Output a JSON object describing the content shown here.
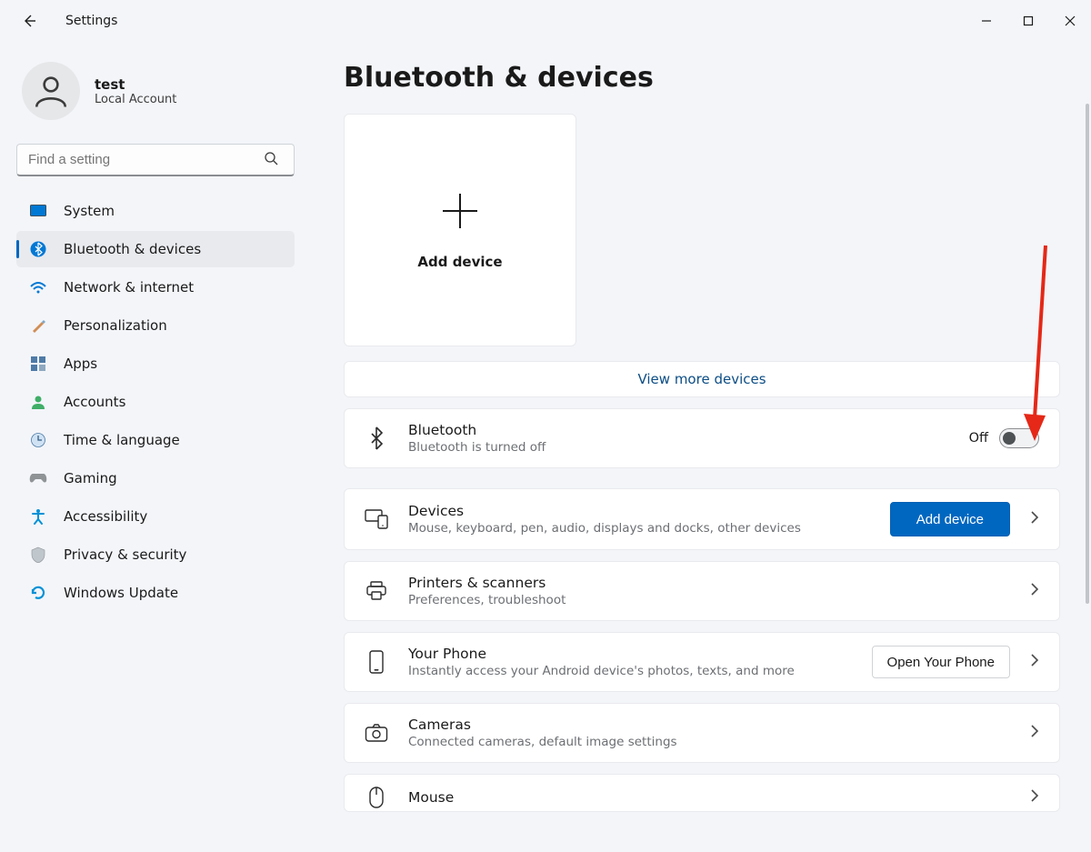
{
  "window": {
    "app_title": "Settings"
  },
  "account": {
    "name": "test",
    "subtitle": "Local Account"
  },
  "search": {
    "placeholder": "Find a setting"
  },
  "nav": {
    "items": [
      {
        "key": "system",
        "label": "System"
      },
      {
        "key": "bluetooth",
        "label": "Bluetooth & devices"
      },
      {
        "key": "network",
        "label": "Network & internet"
      },
      {
        "key": "personal",
        "label": "Personalization"
      },
      {
        "key": "apps",
        "label": "Apps"
      },
      {
        "key": "accounts",
        "label": "Accounts"
      },
      {
        "key": "time",
        "label": "Time & language"
      },
      {
        "key": "gaming",
        "label": "Gaming"
      },
      {
        "key": "accessibility",
        "label": "Accessibility"
      },
      {
        "key": "privacy",
        "label": "Privacy & security"
      },
      {
        "key": "update",
        "label": "Windows Update"
      }
    ],
    "selected": "bluetooth"
  },
  "main": {
    "page_title": "Bluetooth & devices",
    "add_device": "Add device",
    "view_more": "View more devices",
    "bluetooth": {
      "title": "Bluetooth",
      "subtitle": "Bluetooth is turned off",
      "state_label": "Off"
    },
    "devices": {
      "title": "Devices",
      "subtitle": "Mouse, keyboard, pen, audio, displays and docks, other devices",
      "button": "Add device"
    },
    "printers": {
      "title": "Printers & scanners",
      "subtitle": "Preferences, troubleshoot"
    },
    "phone": {
      "title": "Your Phone",
      "subtitle": "Instantly access your Android device's photos, texts, and more",
      "button": "Open Your Phone"
    },
    "cameras": {
      "title": "Cameras",
      "subtitle": "Connected cameras, default image settings"
    },
    "mouse": {
      "title": "Mouse"
    }
  }
}
